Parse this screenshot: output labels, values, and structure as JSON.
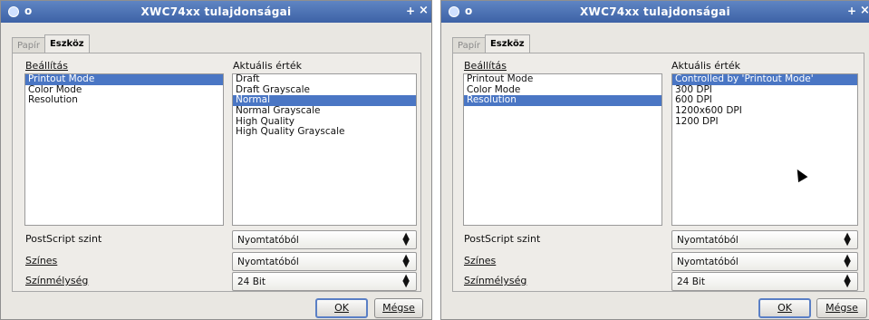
{
  "left": {
    "title": "XWC74xx tulajdonságai",
    "sys_glyph": "o",
    "pin_glyph": "+",
    "close_glyph": "×",
    "tabs": [
      {
        "label": "Papír"
      },
      {
        "label": "Eszköz"
      }
    ],
    "setting_label": "Beállítás",
    "value_label": "Aktuális érték",
    "settings": [
      {
        "label": "Printout Mode"
      },
      {
        "label": "Color Mode"
      },
      {
        "label": "Resolution"
      }
    ],
    "values": [
      {
        "label": "Draft"
      },
      {
        "label": "Draft Grayscale"
      },
      {
        "label": "Normal"
      },
      {
        "label": "Normal Grayscale"
      },
      {
        "label": "High Quality"
      },
      {
        "label": "High Quality Grayscale"
      }
    ],
    "selected_setting_index": 0,
    "selected_value_index": 2,
    "postscript_label": "PostScript szint",
    "postscript_value": "Nyomtatóból",
    "color_label": "Színes",
    "color_value": "Nyomtatóból",
    "depth_label": "Színmélység",
    "depth_value": "24 Bit",
    "ok_label": "OK",
    "cancel_label": "Mégse"
  },
  "right": {
    "title": "XWC74xx tulajdonságai",
    "sys_glyph": "o",
    "pin_glyph": "+",
    "close_glyph": "×",
    "tabs": [
      {
        "label": "Papír"
      },
      {
        "label": "Eszköz"
      }
    ],
    "setting_label": "Beállítás",
    "value_label": "Aktuális érték",
    "settings": [
      {
        "label": "Printout Mode"
      },
      {
        "label": "Color Mode"
      },
      {
        "label": "Resolution"
      }
    ],
    "values": [
      {
        "label": "Controlled by 'Printout Mode'"
      },
      {
        "label": "300 DPI"
      },
      {
        "label": "600 DPI"
      },
      {
        "label": "1200x600 DPI"
      },
      {
        "label": "1200 DPI"
      }
    ],
    "selected_setting_index": 2,
    "selected_value_index": 0,
    "postscript_label": "PostScript szint",
    "postscript_value": "Nyomtatóból",
    "color_label": "Színes",
    "color_value": "Nyomtatóból",
    "depth_label": "Színmélység",
    "depth_value": "24 Bit",
    "ok_label": "OK",
    "cancel_label": "Mégse"
  },
  "colors": {
    "titlebar": "#4a70b4",
    "selection": "#4a76c4",
    "dialog_bg": "#e9e7e2"
  }
}
